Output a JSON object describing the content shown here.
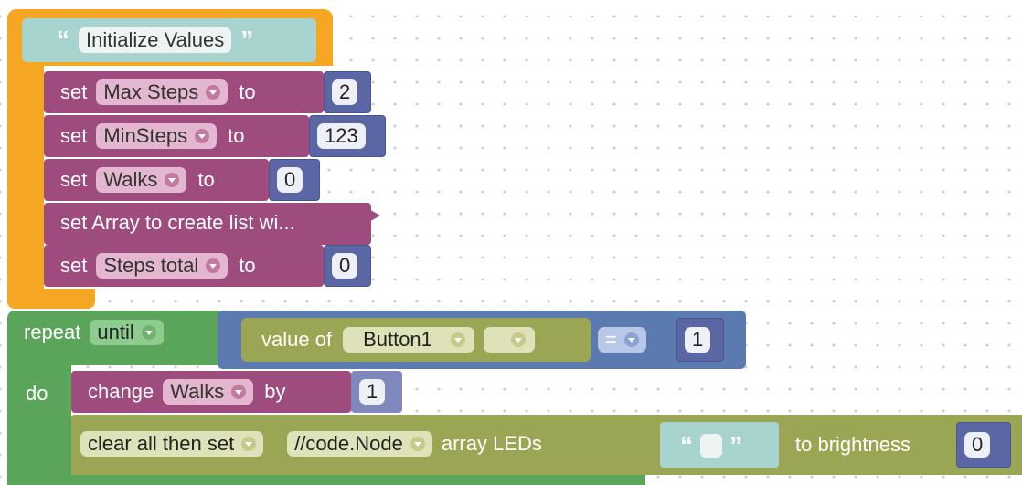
{
  "comment_block": {
    "label": "Initialize Values",
    "open_quote": "“",
    "close_quote": "”"
  },
  "set_blocks": [
    {
      "kw": "set",
      "var": "Max Steps",
      "to": "to",
      "value": "2"
    },
    {
      "kw": "set",
      "var": "MinSteps",
      "to": "to",
      "value": "123"
    },
    {
      "kw": "set",
      "var": "Walks",
      "to": "to",
      "value": "0"
    },
    {
      "kw": "set Array to create list wi..."
    },
    {
      "kw": "set",
      "var": "Steps total",
      "to": "to",
      "value": "0"
    }
  ],
  "repeat_block": {
    "kw": "repeat",
    "mode": "until",
    "do": "do",
    "condition": {
      "value_of": "value of",
      "device": "Button1",
      "blank": "",
      "op": "=",
      "rhs": "1"
    }
  },
  "change_block": {
    "kw": "change",
    "var": "Walks",
    "by": "by",
    "value": "1"
  },
  "led_block": {
    "mode": "clear all then set",
    "node": "//code.Node",
    "array": "array LEDs",
    "quote_open": "“",
    "quote_close": "”",
    "to_brightness": "to brightness",
    "value": "0"
  },
  "colors": {
    "orange": "#f5a623",
    "comment": "#a8d4d0",
    "set_purple": "#9e4b7e",
    "num_blue": "#5b67a5",
    "repeat_green": "#5aa55a",
    "olive": "#9aa653",
    "condition_blue": "#5a7ab0"
  }
}
